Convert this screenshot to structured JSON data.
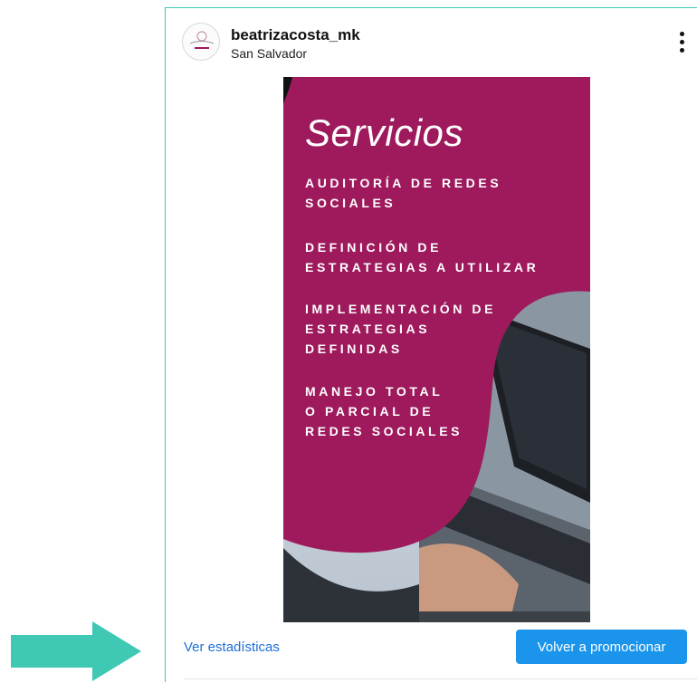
{
  "post": {
    "username": "beatrizacosta_mk",
    "location": "San Salvador",
    "menu_icon": "more-vertical-icon",
    "image": {
      "title": "Servicios",
      "services": [
        "AUDITORÍA DE REDES\nSOCIALES",
        "DEFINICIÓN DE\nESTRATEGIAS A UTILIZAR",
        "IMPLEMENTACIÓN DE\nESTRATEGIAS\nDEFINIDAS",
        "MANEJO TOTAL\nO PARCIAL DE\nREDES SOCIALES"
      ]
    }
  },
  "footer": {
    "insights_link": "Ver estadísticas",
    "promote_button": "Volver a promocionar"
  },
  "colors": {
    "accent_blue": "#1b95ec",
    "link_blue": "#1d6fd6",
    "magenta": "#9e1a5c",
    "arrow_teal": "#3fc8b4"
  }
}
